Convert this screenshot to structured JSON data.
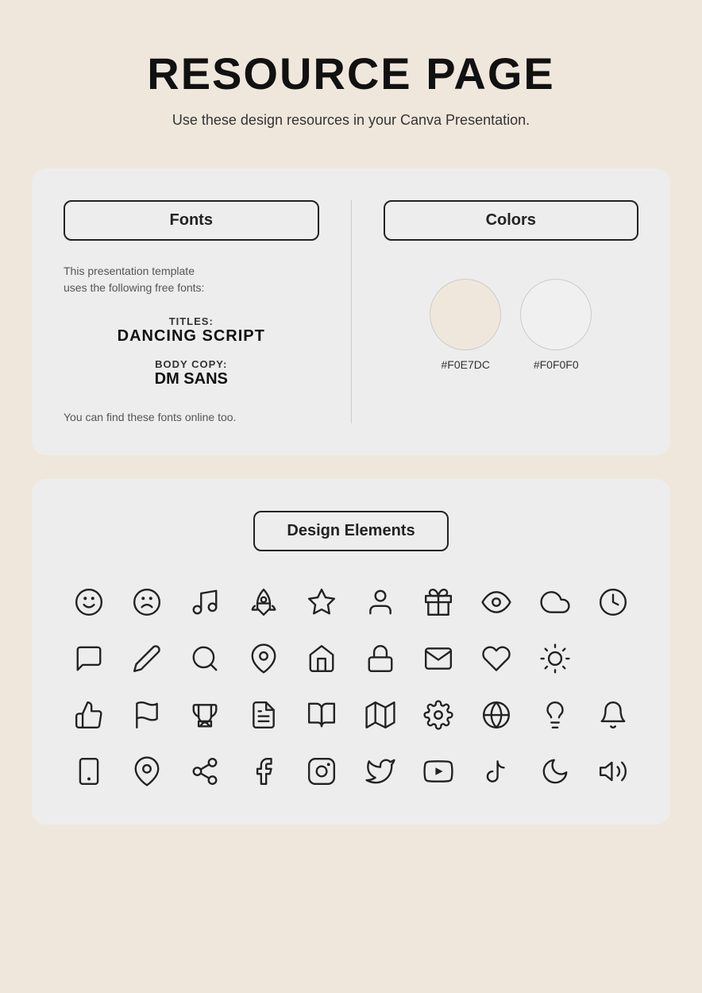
{
  "page": {
    "title": "RESOURCE PAGE",
    "subtitle": "Use these design resources in your Canva Presentation."
  },
  "fonts_section": {
    "header": "Fonts",
    "description_line1": "This presentation template",
    "description_line2": "uses the following free fonts:",
    "title_label": "TITLES:",
    "title_font": "DANCING SCRIPT",
    "body_label": "BODY COPY:",
    "body_font": "DM SANS",
    "footer": "You can find these fonts online too."
  },
  "colors_section": {
    "header": "Colors",
    "swatches": [
      {
        "hex": "#F0E7DC",
        "label": "#F0E7DC"
      },
      {
        "hex": "#F0F0F0",
        "label": "#F0F0F0"
      }
    ]
  },
  "design_elements": {
    "header": "Design Elements"
  }
}
